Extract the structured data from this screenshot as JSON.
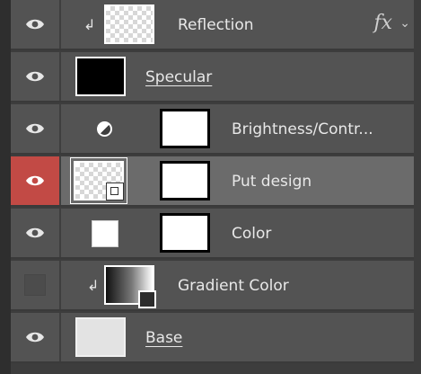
{
  "layers": [
    {
      "name": "Reflection",
      "visible": true,
      "selected": false,
      "clipped": true,
      "thumb": "checker",
      "fx": "fx",
      "chevron": "chevron-down-icon"
    },
    {
      "name": "Specular",
      "visible": true,
      "selected": false,
      "clipped": false,
      "thumb": "black",
      "underline": true
    },
    {
      "name": "Brightness/Contr...",
      "visible": true,
      "selected": false,
      "adjustment": "brightness-contrast-icon",
      "mask": "white"
    },
    {
      "name": "Put design",
      "visible": true,
      "selected": true,
      "thumb": "smart-object-checker",
      "mask": "white"
    },
    {
      "name": "Color",
      "visible": true,
      "selected": false,
      "thumb": "solid-white",
      "mask": "white"
    },
    {
      "name": "Gradient Color",
      "visible": false,
      "selected": false,
      "clipped": true,
      "thumb": "gradient"
    },
    {
      "name": "Base",
      "visible": true,
      "selected": false,
      "thumb": "light-gray",
      "underline": true
    }
  ],
  "colors": {
    "panel": "#535353",
    "selected_eye_bg": "#c24a45",
    "selected_row": "#6b6b6b",
    "text": "#e8e8e8"
  }
}
